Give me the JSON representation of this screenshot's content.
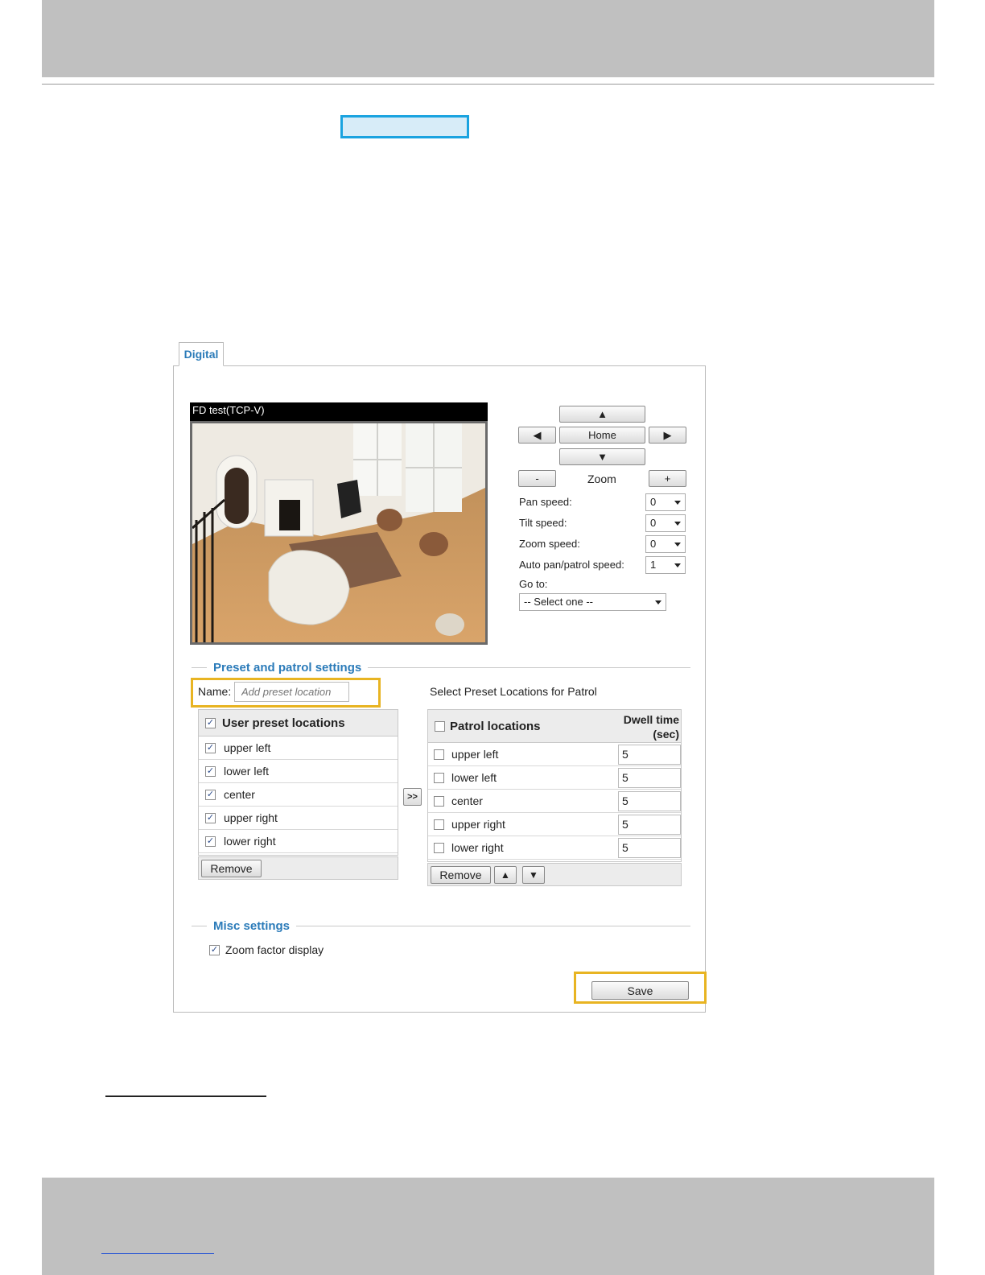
{
  "tabs": {
    "digital": "Digital"
  },
  "camera": {
    "title": "FD test(TCP-V)"
  },
  "ptz": {
    "up": "▲",
    "down": "▼",
    "left": "◀",
    "right": "▶",
    "home": "Home",
    "zoom_label": "Zoom",
    "zoom_out": "-",
    "zoom_in": "+",
    "pan_speed_label": "Pan speed:",
    "pan_speed": "0",
    "tilt_speed_label": "Tilt speed:",
    "tilt_speed": "0",
    "zoom_speed_label": "Zoom speed:",
    "zoom_speed": "0",
    "auto_speed_label": "Auto pan/patrol speed:",
    "auto_speed": "1",
    "goto_label": "Go to:",
    "goto_value": "-- Select one --"
  },
  "preset": {
    "section_title": "Preset and patrol settings",
    "name_label": "Name:",
    "name_placeholder": "Add preset location",
    "patrol_heading": "Select Preset Locations for Patrol",
    "user_header": "User preset locations",
    "user_items": [
      {
        "label": "upper left",
        "checked": true
      },
      {
        "label": "lower left",
        "checked": true
      },
      {
        "label": "center",
        "checked": true
      },
      {
        "label": "upper right",
        "checked": true
      },
      {
        "label": "lower right",
        "checked": true
      }
    ],
    "remove_label": "Remove",
    "move_label": ">>",
    "patrol_header": "Patrol locations",
    "dwell_header_1": "Dwell time",
    "dwell_header_2": "(sec)",
    "patrol_items": [
      {
        "label": "upper left",
        "dwell": "5"
      },
      {
        "label": "lower left",
        "dwell": "5"
      },
      {
        "label": "center",
        "dwell": "5"
      },
      {
        "label": "upper right",
        "dwell": "5"
      },
      {
        "label": "lower right",
        "dwell": "5"
      }
    ],
    "patrol_remove_label": "Remove",
    "up_label": "▲",
    "down_label": "▼"
  },
  "misc": {
    "section_title": "Misc settings",
    "zoom_factor_label": "Zoom factor display",
    "zoom_factor_checked": true
  },
  "save_label": "Save",
  "colors": {
    "accent": "#2b7bb9",
    "highlight": "#e8b422",
    "header_blue": "#1aa3e0"
  }
}
